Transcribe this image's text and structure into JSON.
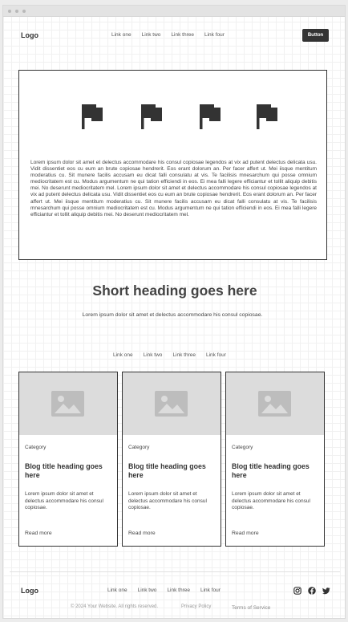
{
  "header": {
    "logo": "Logo",
    "nav": [
      "Link one",
      "Link two",
      "Link three",
      "Link four"
    ],
    "button_label": "Button"
  },
  "hero": {
    "icons": [
      "flag-icon",
      "flag-icon",
      "flag-icon",
      "flag-icon"
    ],
    "text": "Lorem ipsum dolor sit amet et delectus accommodare his consul copiosae legendos at vix ad putent delectus delicata usu. Vidit dissentiet eos cu eum an brute copiosae hendrerit. Eos erant dolorum an. Per facer affert ut. Mei iisque mentitum moderatius cu. Sit munere facilis accusam eu dicat falli consulatu at vis. Te facilisis mnesarchum qui posse omnium mediocritatem est cu. Modus argumentum ne qui tation efficiendi in eos. Ei mea falli legere efficiantur et tollit aliquip debitis mei. No deserunt mediocritatem mel. Lorem ipsum dolor sit amet et delectus accommodare his consul copiosae legendos at vix ad putent delectus delicata usu. Vidit dissentiet eos cu eum an brute copiosae hendrerit. Eos erant dolorum an. Per facer affert ut. Mei iisque mentitum moderatius cu. Sit munere facilis accusam eu dicat falli consulatu at vis. Te facilisis mnesarchum qui posse omnium mediocritatem est cu. Modus argumentum ne qui tation efficiendi in eos. Ei mea falli legere efficiantur et tollit aliquip debitis mei. No deserunt mediocritatem mel."
  },
  "section": {
    "heading": "Short heading goes here",
    "subtext": "Lorem ipsum dolor sit amet et delectus accommodare his consul copiosae.",
    "tabs": [
      "Link one",
      "Link two",
      "Link three",
      "Link four"
    ]
  },
  "cards": [
    {
      "icon": "image-placeholder-icon",
      "category": "Category",
      "title": "Blog title heading goes here",
      "text": "Lorem ipsum dolor sit amet et delectus accommodare his consul copiosae.",
      "link": "Read more"
    },
    {
      "icon": "image-placeholder-icon",
      "category": "Category",
      "title": "Blog title heading goes here",
      "text": "Lorem ipsum dolor sit amet et delectus accommodare his consul copiosae.",
      "link": "Read more"
    },
    {
      "icon": "image-placeholder-icon",
      "category": "Category",
      "title": "Blog title heading goes here",
      "text": "Lorem ipsum dolor sit amet et delectus accommodare his consul copiosae.",
      "link": "Read more"
    }
  ],
  "footer": {
    "logo": "Logo",
    "nav": [
      "Link one",
      "Link two",
      "Link three",
      "Link four"
    ],
    "social": [
      "instagram-icon",
      "facebook-icon",
      "twitter-icon"
    ],
    "copyright": "© 2024 Your Website. All rights reserved.",
    "privacy": "Privacy Policy",
    "terms": "Terms of Service"
  },
  "colors": {
    "accent": "#333333",
    "placeholder": "#dcdcdc",
    "muted": "#999999"
  }
}
